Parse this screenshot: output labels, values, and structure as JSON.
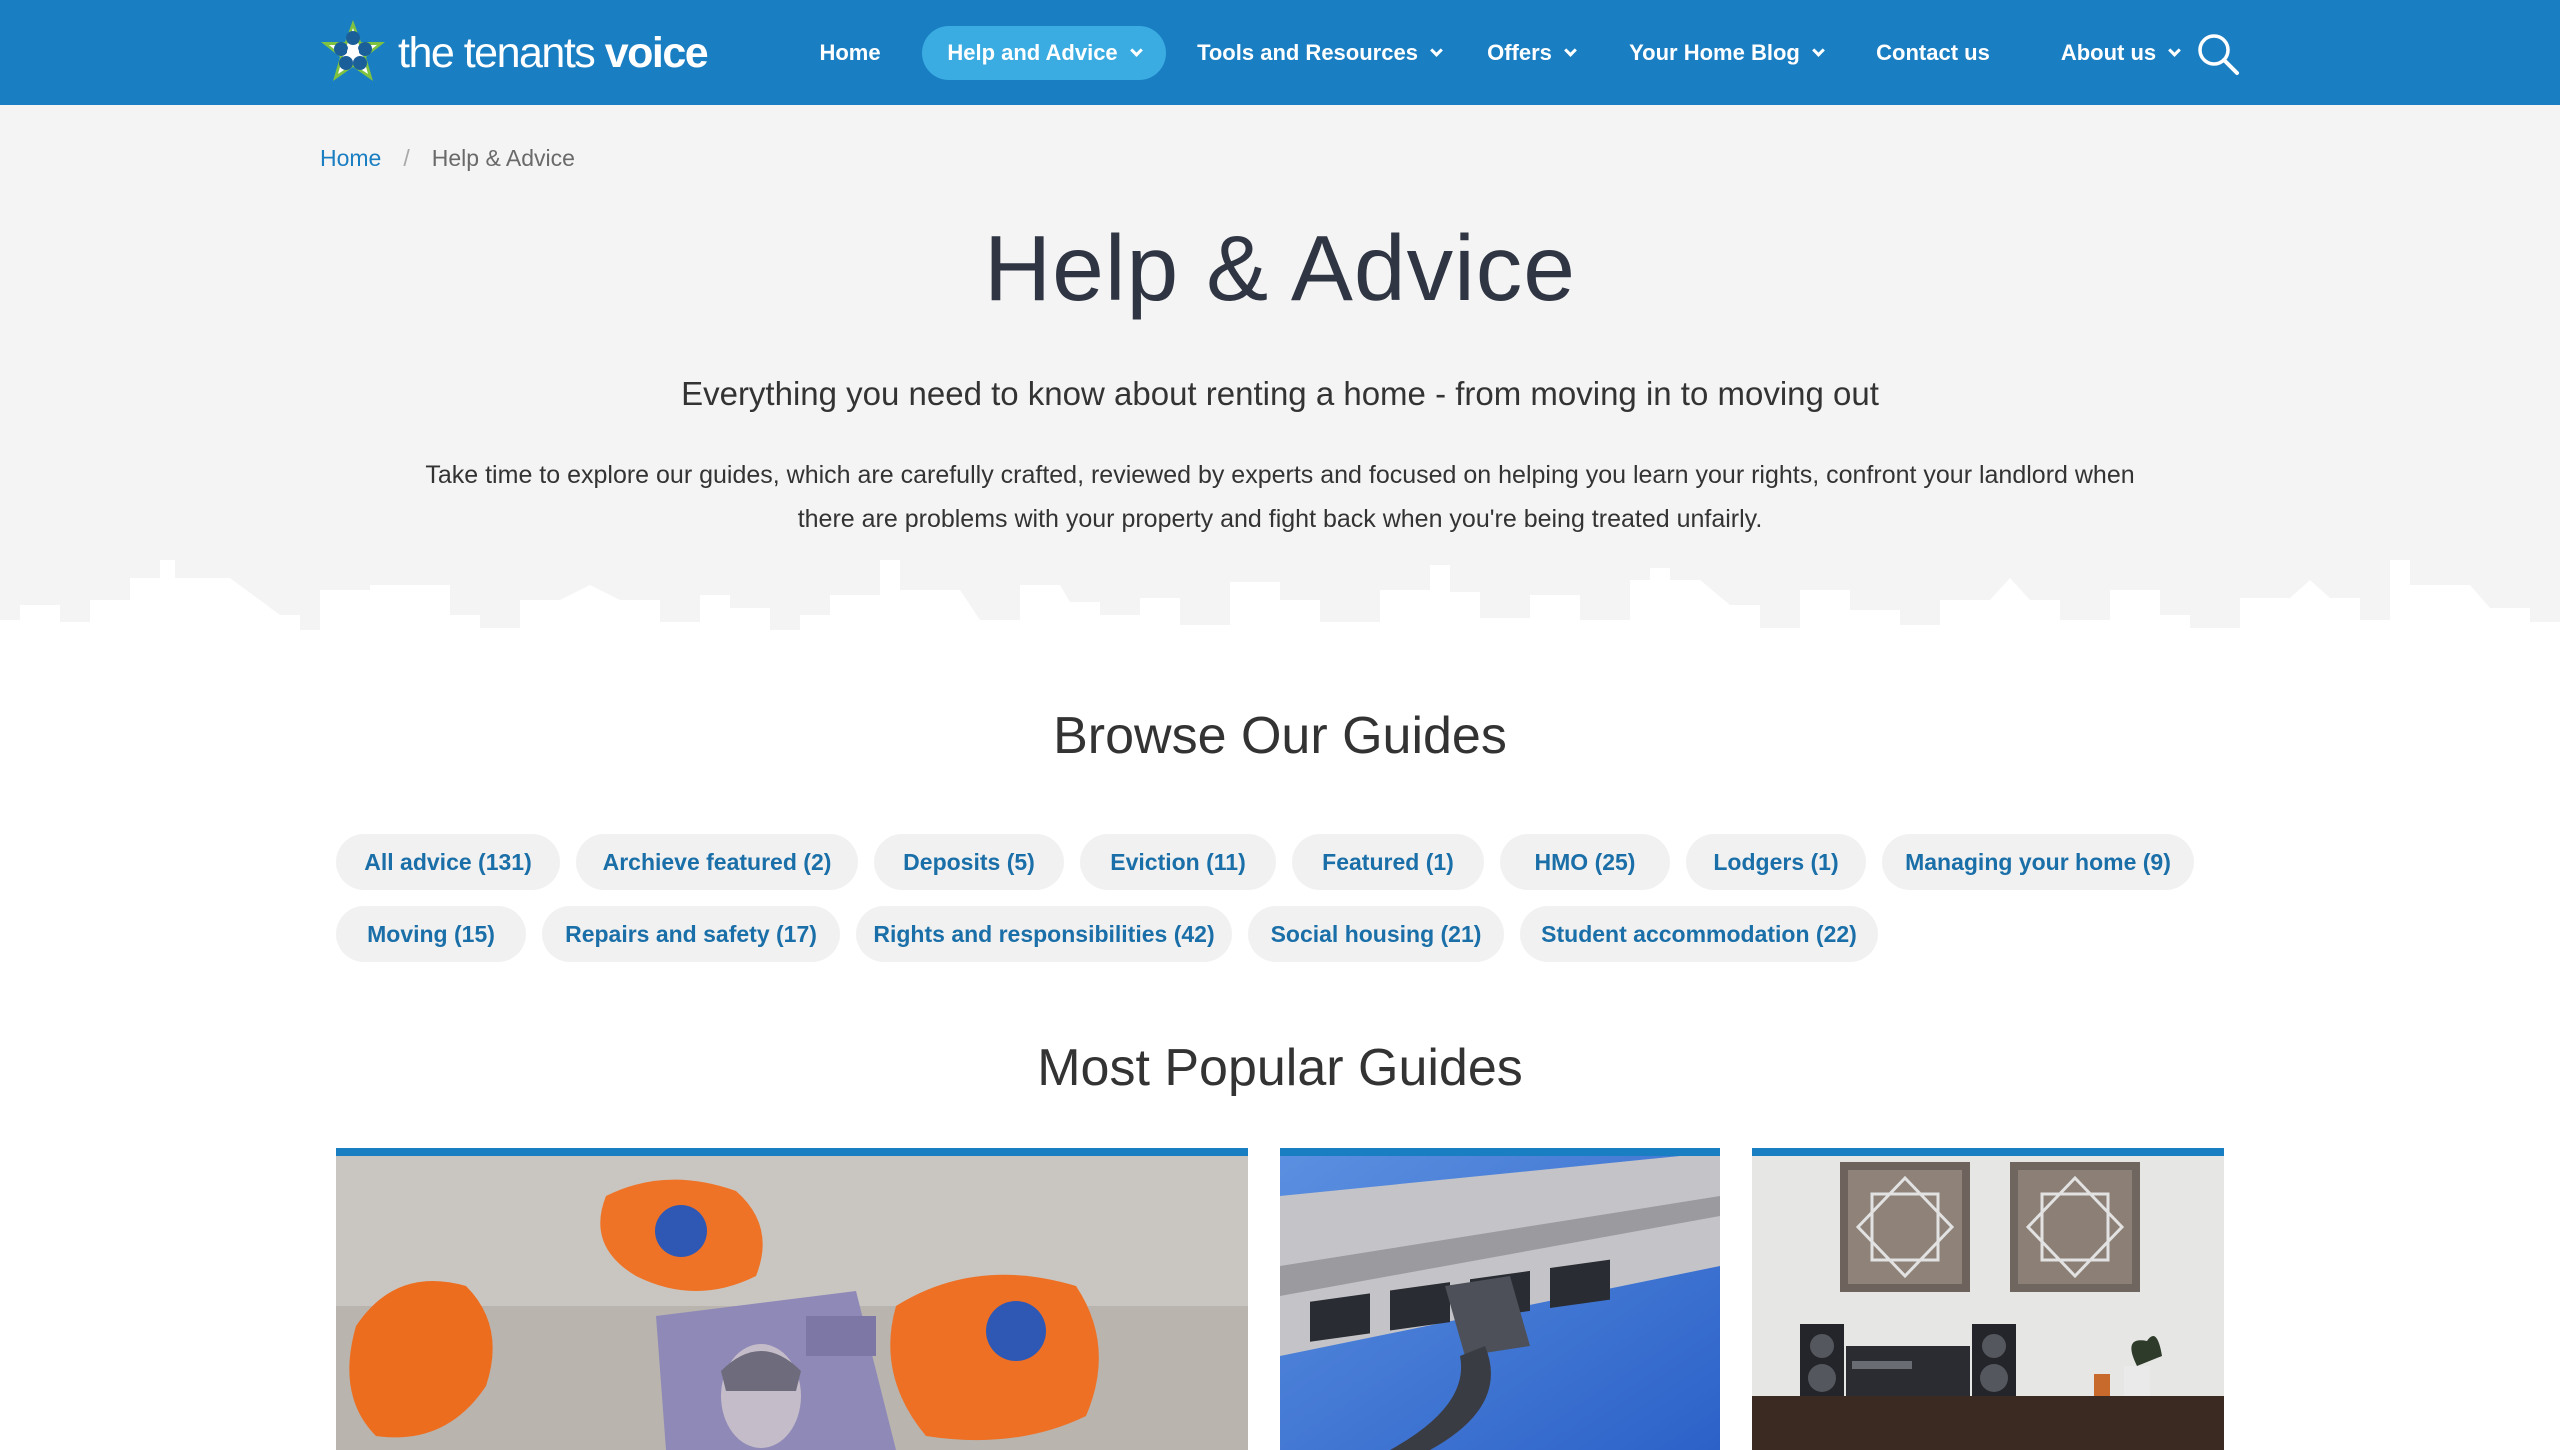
{
  "brand": {
    "logo_light": "the tenants ",
    "logo_bold": "voice",
    "primary_color": "#1a7ec2",
    "active_nav_color": "#3aace2"
  },
  "nav": {
    "items": [
      {
        "label": "Home",
        "has_dropdown": false,
        "active": false
      },
      {
        "label": "Help and Advice",
        "has_dropdown": true,
        "active": true
      },
      {
        "label": "Tools and Resources",
        "has_dropdown": true,
        "active": false
      },
      {
        "label": "Offers",
        "has_dropdown": true,
        "active": false
      },
      {
        "label": "Your Home Blog",
        "has_dropdown": true,
        "active": false
      },
      {
        "label": "Contact us",
        "has_dropdown": false,
        "active": false
      },
      {
        "label": "About us",
        "has_dropdown": true,
        "active": false
      }
    ],
    "search_icon": "search-icon"
  },
  "breadcrumb": {
    "home": "Home",
    "separator": "/",
    "current": "Help & Advice"
  },
  "hero": {
    "title": "Help & Advice",
    "subtitle": "Everything you need to know about renting a home - from moving in to moving out",
    "intro": "Take time to explore our guides, which are carefully crafted, reviewed by experts and focused on helping you learn your rights, confront your landlord when there are problems with your property and fight back when you're being treated unfairly."
  },
  "social": {
    "twitter_icon": "twitter-icon",
    "facebook_icon": "facebook-icon"
  },
  "browse": {
    "title": "Browse Our Guides",
    "categories": [
      "All advice (131)",
      "Archieve featured (2)",
      "Deposits (5)",
      "Eviction (11)",
      "Featured (1)",
      "HMO (25)",
      "Lodgers (1)",
      "Managing your home (9)",
      "Moving (15)",
      "Repairs and safety (17)",
      "Rights and responsibilities (42)",
      "Social housing (21)",
      "Student accommodation (22)"
    ]
  },
  "popular": {
    "title": "Most Popular Guides",
    "cards": [
      {
        "image": "broken-piggy-bank-banknote-image"
      },
      {
        "image": "ethernet-cable-router-image"
      },
      {
        "image": "living-room-stereo-artwork-image"
      }
    ]
  }
}
